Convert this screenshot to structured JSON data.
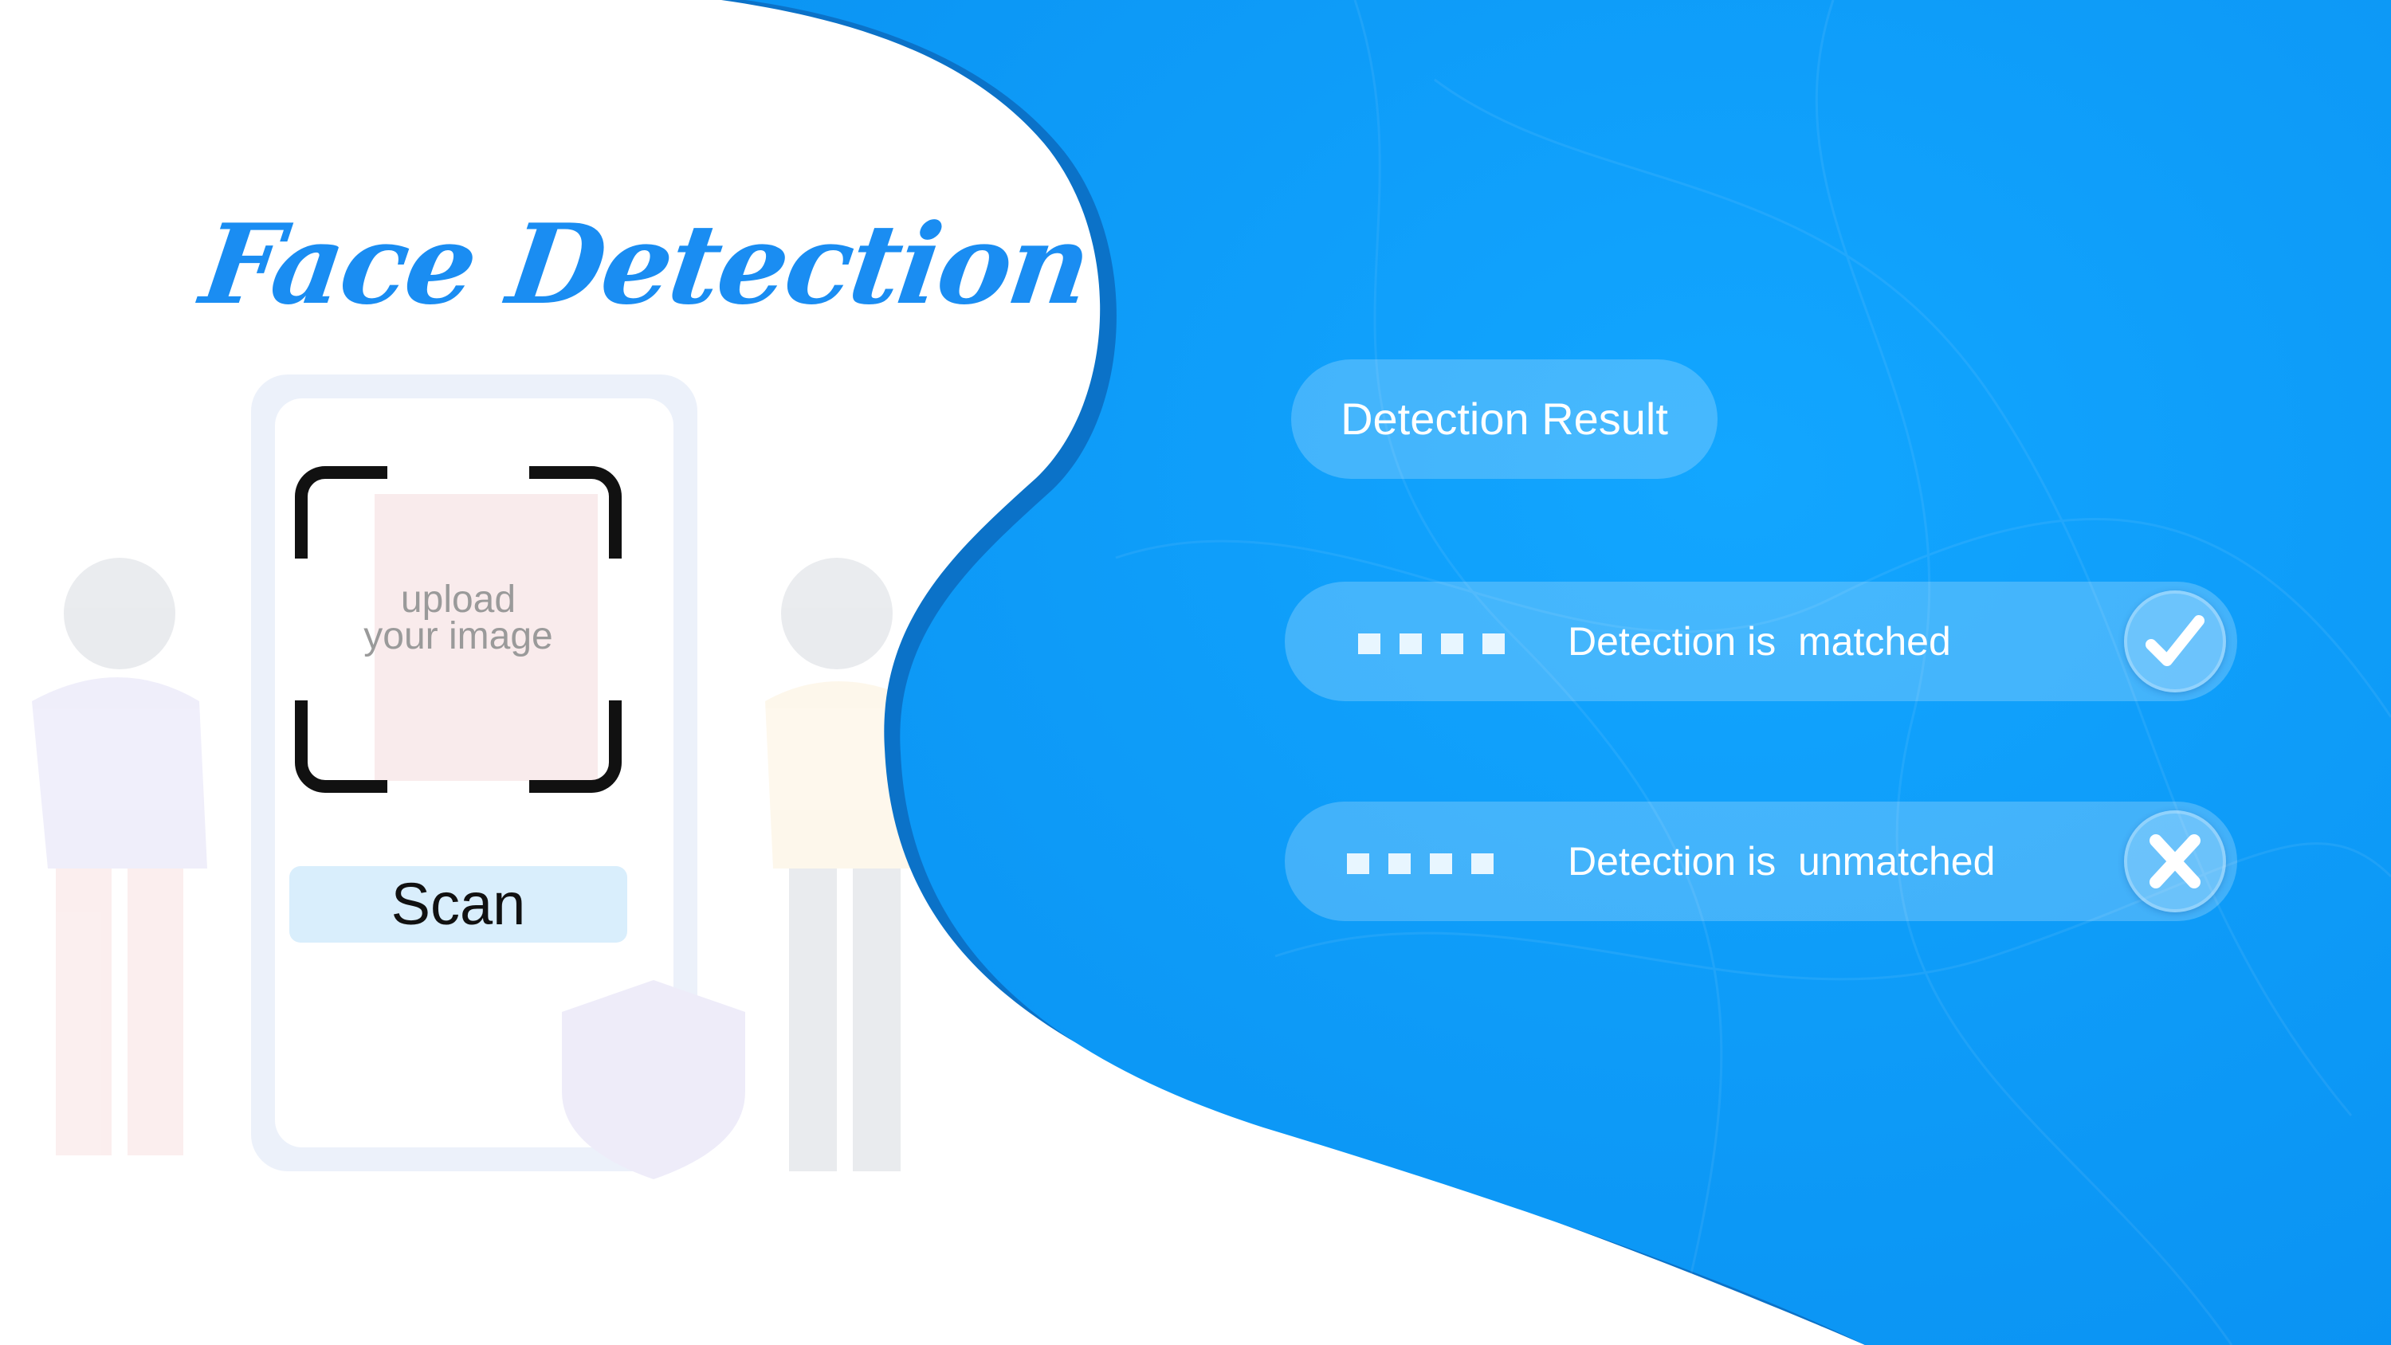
{
  "title": "Face Detection",
  "scanner": {
    "upload_line1": "upload",
    "upload_line2": "your  image",
    "scan_label": "Scan"
  },
  "results": {
    "heading": "Detection Result",
    "rows": [
      {
        "label": "Detection is  matched",
        "status_icon": "checkmark-icon"
      },
      {
        "label": "Detection is  unmatched",
        "status_icon": "x-icon"
      }
    ]
  },
  "colors": {
    "brand_blue": "#0a9af7",
    "wave_edge": "#0b72c8",
    "title_blue": "#1a8df2",
    "scan_button_bg": "#d9eefc"
  }
}
